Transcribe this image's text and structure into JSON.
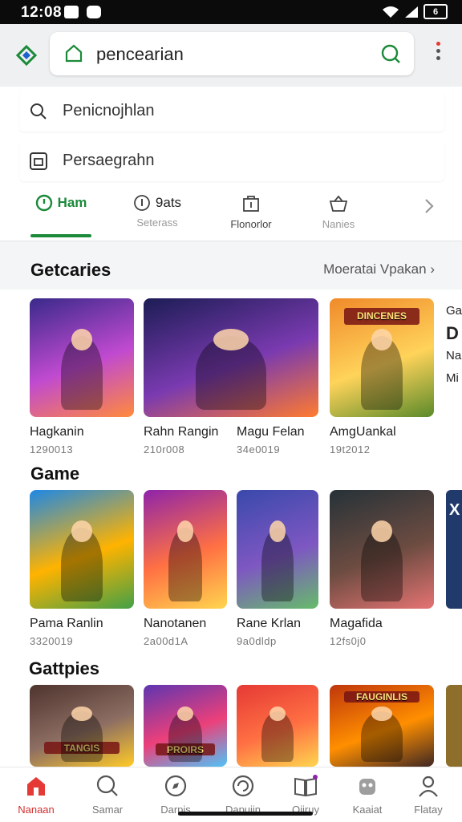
{
  "status_bar": {
    "time": "12:08",
    "battery": "6"
  },
  "search": {
    "value": "pencearian"
  },
  "suggestions": [
    {
      "label": "Penicnojhlan"
    },
    {
      "label": "Persaegrahn"
    }
  ],
  "tabs": [
    {
      "label": "Ham",
      "sub": "",
      "icon": "clock-icon",
      "active": true
    },
    {
      "label": "9ats",
      "sub": "Seterass",
      "icon": "info-icon",
      "active": false
    },
    {
      "label": "",
      "sub": "Flonorlor",
      "icon": "store-icon",
      "active": false
    },
    {
      "label": "",
      "sub": "Nanies",
      "icon": "basket-icon",
      "active": false
    }
  ],
  "sections": [
    {
      "title": "Getcaries",
      "more": "Moeratai Vpakan",
      "items": [
        {
          "name": "Hagkanin",
          "sub": "1290013",
          "banner": "",
          "colors": [
            "#3a2a8a",
            "#c04ad0",
            "#ff8a3c"
          ]
        },
        {
          "name": "Rahn Rangin",
          "sub": "210r008",
          "banner": "",
          "colors": [
            "#1c1d55",
            "#7a3ab0",
            "#ff7b2e"
          ]
        },
        {
          "name": "Magu Felan",
          "sub": "34e0019",
          "banner": "",
          "colors": [
            "#1c1d55",
            "#7a3ab0",
            "#ff7b2e"
          ]
        },
        {
          "name": "AmgUankal",
          "sub": "19t2012",
          "banner": "DINCENES",
          "colors": [
            "#f08a2a",
            "#ffd35a",
            "#5a8a2a"
          ]
        }
      ],
      "edge": {
        "lines": [
          "Ga",
          "D",
          "Na",
          "Mi"
        ]
      }
    },
    {
      "title": "Game",
      "more": "",
      "items": [
        {
          "name": "Pama Ranlin",
          "sub": "3320019",
          "banner": "",
          "colors": [
            "#1e88e5",
            "#ffb300",
            "#43a047"
          ]
        },
        {
          "name": "Nanotanen",
          "sub": "2a00d1A",
          "banner": "",
          "colors": [
            "#8e24aa",
            "#ff7043",
            "#ffd54f"
          ]
        },
        {
          "name": "Rane Krlan",
          "sub": "9a0dldp",
          "banner": "",
          "colors": [
            "#3949ab",
            "#7e57c2",
            "#66bb6a"
          ]
        },
        {
          "name": "Magafida",
          "sub": "12fs0j0",
          "banner": "",
          "colors": [
            "#263238",
            "#6d4c41",
            "#e57373"
          ]
        }
      ],
      "edge": {
        "lines": [
          "X"
        ]
      }
    },
    {
      "title": "Gattpies",
      "more": "",
      "items": [
        {
          "name": "",
          "sub": "",
          "banner": "TANGIS",
          "colors": [
            "#4e342e",
            "#8d6e63",
            "#ffca28"
          ]
        },
        {
          "name": "",
          "sub": "",
          "banner": "PROIRS",
          "colors": [
            "#5e35b1",
            "#ec407a",
            "#4fc3f7"
          ]
        },
        {
          "name": "",
          "sub": "",
          "banner": "",
          "colors": [
            "#e53935",
            "#ff7043",
            "#ffd54f"
          ]
        },
        {
          "name": "",
          "sub": "",
          "banner": "FAUGINLIS",
          "colors": [
            "#bf360c",
            "#ff8f00",
            "#3e2723"
          ]
        }
      ],
      "edge": {
        "lines": [
          ""
        ]
      }
    }
  ],
  "bottom_nav": [
    {
      "label": "Nanaan",
      "icon": "home-icon",
      "active": true
    },
    {
      "label": "Samar",
      "icon": "search-icon",
      "active": false
    },
    {
      "label": "Darpis",
      "icon": "explore-icon",
      "active": false
    },
    {
      "label": "Dapuiin",
      "icon": "refresh-icon",
      "active": false
    },
    {
      "label": "Oiiruy",
      "icon": "book-icon",
      "active": false
    },
    {
      "label": "Kaaiat",
      "icon": "gamepad-icon",
      "active": false
    },
    {
      "label": "Flatay",
      "icon": "profile-icon",
      "active": false
    }
  ],
  "accent": "#1b8a3a"
}
